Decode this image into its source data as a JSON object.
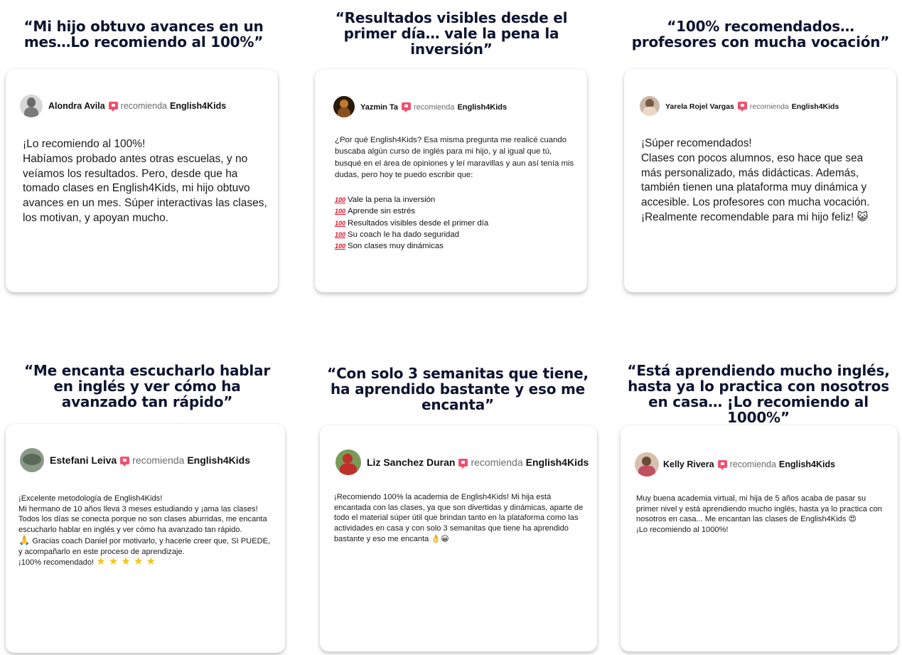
{
  "testimonials": [
    {
      "headline": "“Mi hijo obtuvo avances en un mes…Lo recomiendo al 100%”",
      "author": "Alondra Avila",
      "recommends": "recomienda",
      "brand": "English4Kids",
      "body": "¡Lo recomiendo al 100%!\nHabíamos probado antes otras escuelas, y no veíamos los resultados. Pero, desde que ha tomado clases en English4Kids, mi hijo obtuvo avances en un mes. Súper interactivas las clases, los motivan, y apoyan mucho.",
      "avatar_color": "#8a8a8a"
    },
    {
      "headline": "“Resultados visibles desde el primer día… vale la pena la inversión”",
      "author": "Yazmin Ta",
      "recommends": "recomienda",
      "brand": "English4Kids",
      "body": "¿Por qué English4Kids? Esa misma pregunta me realicé cuando buscaba algún curso de inglés para mi hijo, y al igual que tú, busqué en el área de opiniones y leí maravillas y aun así tenía mis dudas, pero hoy te puedo escribir que:",
      "list": [
        "Vale la pena la inversión",
        "Aprende sin estrés",
        "Resultados visibles desde el primer día",
        "Su coach le ha dado seguridad",
        "Son clases muy dinámicas"
      ],
      "list_marker": "100",
      "avatar_color": "#5a3a1a"
    },
    {
      "headline": "“100% recomendados… profesores con mucha vocación”",
      "author": "Yarela Rojel Vargas",
      "recommends": "recomienda",
      "brand": "English4Kids",
      "body": "¡Súper recomendados!\nClases con pocos alumnos, eso hace que sea más personalizado, más didácticas. Además, también tienen una plataforma muy dinámica y accesible. Los profesores con mucha vocación. ¡Realmente recomendable para mi hijo feliz!",
      "emoji": "😺",
      "avatar_color": "#7a6a5a"
    },
    {
      "headline": "“Me encanta escucharlo hablar en inglés y ver cómo ha avanzado tan rápido”",
      "author": "Estefani Leiva",
      "recommends": "recomienda",
      "brand": "English4Kids",
      "body": "¡Excelente metodología de English4Kids!\nMi hermano de 10 años lleva 3 meses estudiando y ¡ama las clases! Todos los días se conecta porque no son clases aburridas, me encanta escucharlo hablar en inglés y ver cómo ha avanzado tan rápido.",
      "pray_line": "Gracias coach Daniel por motivarlo, y hacerle creer que, SI PUEDE, y acompañarlo en este proceso de aprendizaje.",
      "closing": "¡100% recomendado!",
      "avatar_color": "#6a7a6a"
    },
    {
      "headline": "“Con solo 3 semanitas que tiene, ha aprendido bastante y eso me encanta”",
      "author": "Liz Sanchez Duran",
      "recommends": "recomienda",
      "brand": "English4Kids",
      "body": "¡Recomiendo 100% la academia de English4Kids! Mi hija está encantada con las clases, ya que son divertidas y dinámicas, aparte de todo el material súper útil que brindan tanto en la plataforma como las actividades en casa y con solo 3 semanitas que tiene ha aprendido bastante y eso me encanta",
      "emoji": "👌😀",
      "avatar_color": "#9a4a3a"
    },
    {
      "headline": "“Está aprendiendo mucho inglés, hasta ya lo practica con nosotros en casa… ¡Lo recomiendo al 1000%”",
      "author": "Kelly Rivera",
      "recommends": "recomienda",
      "brand": "English4Kids",
      "body": "Muy buena academia virtual, mi hija de 5 años acaba de pasar su primer nivel y está aprendiendo mucho inglés, hasta ya lo practica con nosotros en casa... Me encantan las clases de English4Kids",
      "emoji": "😍",
      "closing": "¡Lo recomiendo al 1000%!",
      "avatar_color": "#b89a8a"
    }
  ],
  "colors": {
    "headline": "#0d1330",
    "recommend_icon": "#f0506e",
    "hundred_marker": "#e0102a"
  }
}
